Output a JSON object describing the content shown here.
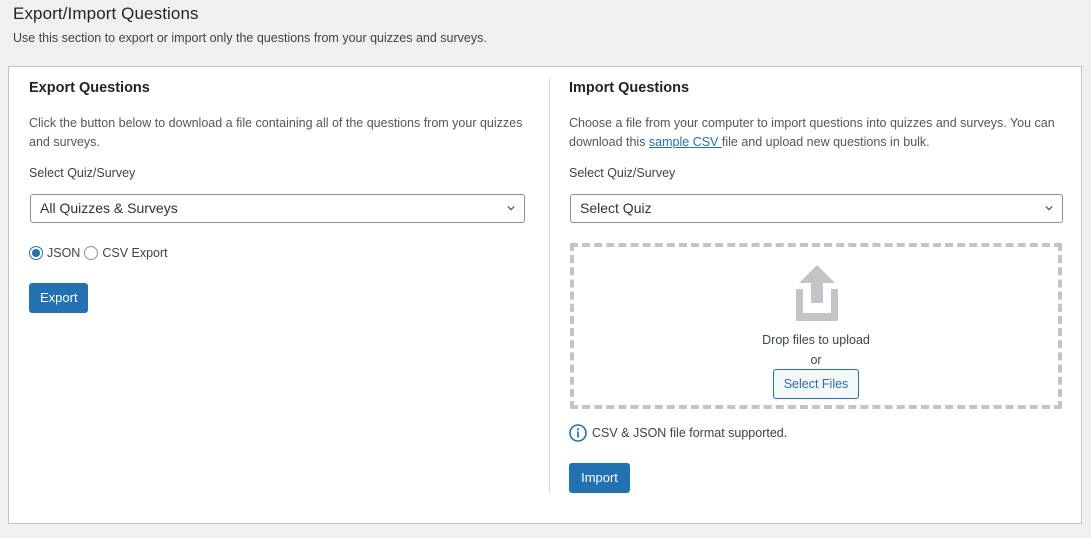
{
  "header": {
    "title": "Export/Import Questions",
    "description": "Use this section to export or import only the questions from your quizzes and surveys."
  },
  "export": {
    "title": "Export Questions",
    "description": "Click the button below to download a file containing all of the questions from your quizzes and surveys.",
    "select_label": "Select Quiz/Survey",
    "select_value": "All Quizzes & Surveys",
    "format_options": [
      {
        "label": "JSON",
        "checked": true
      },
      {
        "label": "CSV Export",
        "checked": false
      }
    ],
    "button_label": "Export"
  },
  "import": {
    "title": "Import Questions",
    "description_before": "Choose a file from your computer to import questions into quizzes and surveys. You can download this ",
    "sample_link": "sample CSV ",
    "description_after": "file and upload new questions in bulk.",
    "select_label": "Select Quiz/Survey",
    "select_value": "Select Quiz",
    "dropzone": {
      "icon": "upload-icon",
      "text": "Drop files to upload",
      "or": "or",
      "button_label": "Select Files"
    },
    "hint_icon": "info-icon",
    "hint": "CSV & JSON file format supported.",
    "button_label": "Import"
  },
  "colors": {
    "accent": "#2271b1",
    "background": "#f0f0f1",
    "dropzone_border": "#c3c4c7"
  }
}
